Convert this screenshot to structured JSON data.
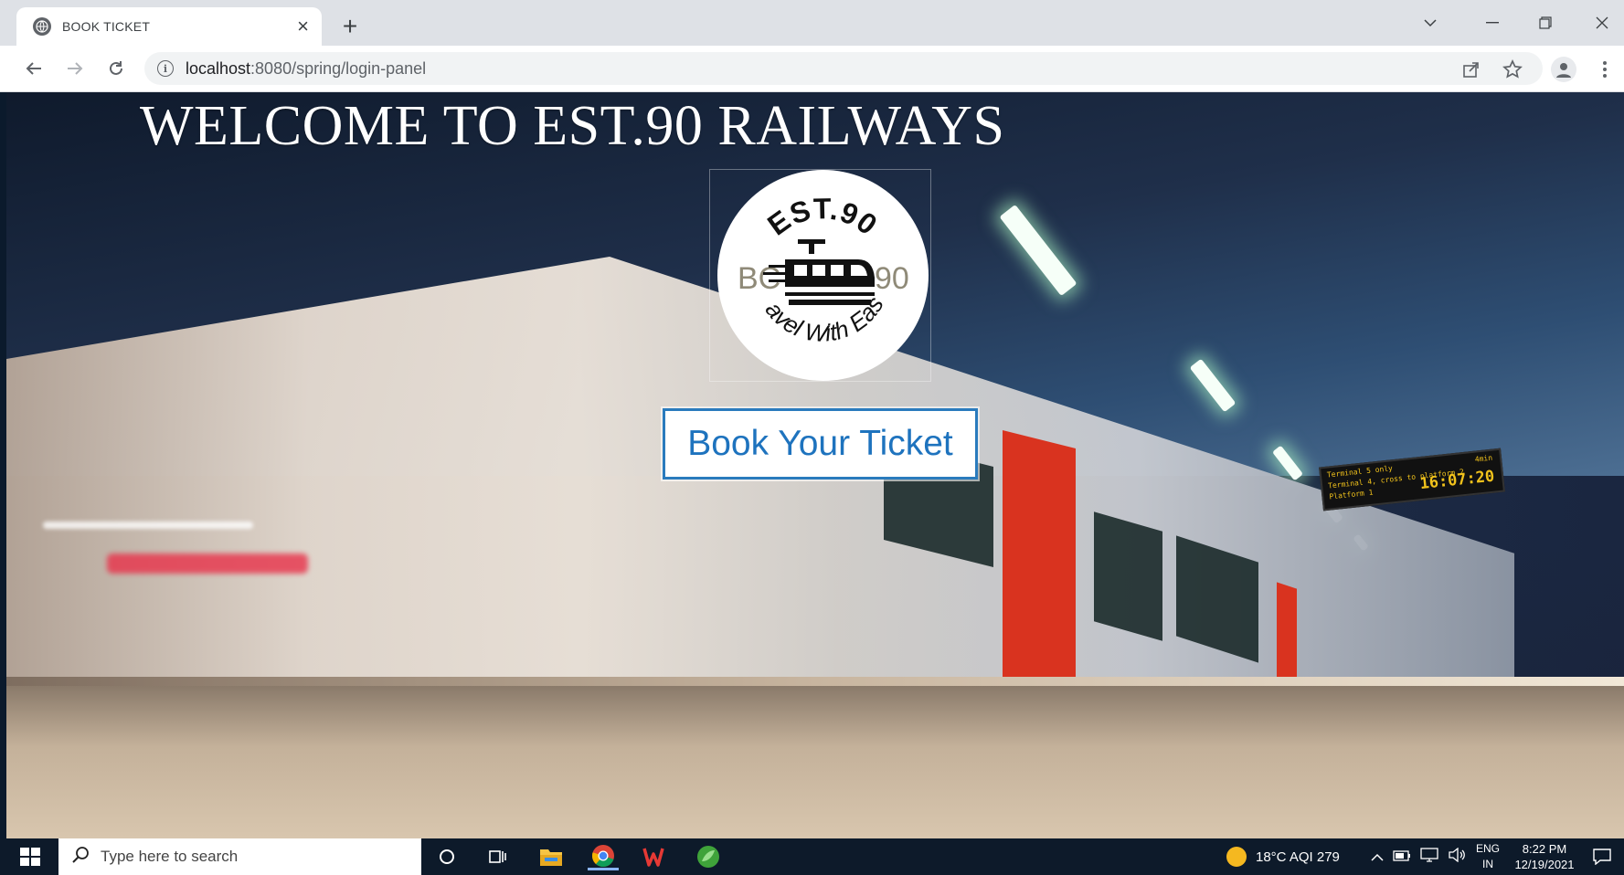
{
  "browser": {
    "tab_title": "BOOK TICKET",
    "tab_close": "×",
    "new_tab": "+",
    "url_host": "localhost",
    "url_rest": ":8080/spring/login-panel",
    "icons": {
      "favicon": "globe-icon",
      "back": "arrow-left-icon",
      "forward": "arrow-right-icon",
      "reload": "reload-icon",
      "info": "info-icon",
      "share": "share-icon",
      "bookmark": "star-icon",
      "profile": "profile-icon",
      "menu": "kebab-menu-icon"
    }
  },
  "page": {
    "headline": "WELCOME TO EST.90 RAILWAYS",
    "logo": {
      "top_text": "EST.90",
      "left_text": "BC",
      "right_text": "90",
      "bottom_text": "Travel With Ease"
    },
    "book_button": "Book Your Ticket",
    "board": {
      "line1": "Terminal 5 only",
      "line2": "Terminal 4, cross to platform 2",
      "line3": "Platform 1",
      "top_right": "4min",
      "time": "16:07:20"
    }
  },
  "taskbar": {
    "search_placeholder": "Type here to search",
    "weather": "18°C  AQI 279",
    "language_top": "ENG",
    "language_bottom": "IN",
    "time": "8:22 PM",
    "date": "12/19/2021"
  },
  "colors": {
    "accent_blue": "#1e73be",
    "taskbar": "#0d1a2a",
    "chrome": "#dee1e6"
  }
}
